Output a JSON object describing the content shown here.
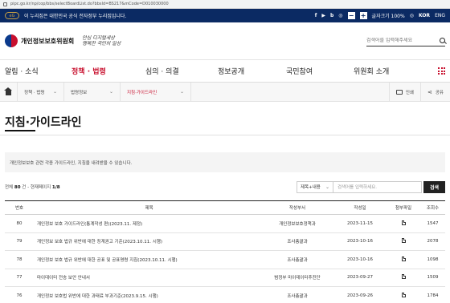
{
  "browser": {
    "url": "pipc.go.kr/np/cop/bbs/selectBoardList.do?bbsId=BS217&mCode=D010030000"
  },
  "govbar": {
    "logo_text": "eG",
    "notice": "이 누리집은 대한민국 공식 전자정부 누리집입니다.",
    "sns": [
      "f",
      "▶",
      "b",
      "◎"
    ],
    "font_minus": "−",
    "font_plus": "+",
    "font_label": "글자크기 100%",
    "lang_kor": "KOR",
    "lang_eng": "ENG"
  },
  "header": {
    "org_name": "개인정보보호위원회",
    "slogan_line1": "안심 디지털세상",
    "slogan_line2": "행복한 국민의 일상",
    "search_placeholder": "검색어를 입력해주세요"
  },
  "gnb": {
    "items": [
      "알림 · 소식",
      "정책 · 법령",
      "심의 · 의결",
      "정보공개",
      "국민참여",
      "위원회 소개"
    ],
    "active_index": 1
  },
  "breadcrumb": {
    "items": [
      "정책 · 법령",
      "법령정보",
      "지침·가이드라인"
    ],
    "chevron": "⌄",
    "print": "인쇄",
    "share": "공유",
    "share_glyph": "⋖"
  },
  "page": {
    "title": "지침·가이드라인",
    "notice": "개인정보보호 관련 각종 가이드라인, 지침을 내려받을 수 있습니다."
  },
  "list": {
    "count_prefix": "전체",
    "count": "80",
    "count_mid": "건 - 현재페이지",
    "page": "1/8",
    "search_type": "제목+내용",
    "search_placeholder": "검색어를 입력하세요.",
    "search_button": "검색"
  },
  "table": {
    "headers": [
      "번호",
      "제목",
      "작성부서",
      "작성일",
      "첨부파일",
      "조회수"
    ],
    "rows": [
      {
        "num": "80",
        "title": "개인정보 보호 가이드라인(통계작성 편)(2023.11. 제정)",
        "dept": "개인정보보호정책과",
        "date": "2023-11-15",
        "views": "1547"
      },
      {
        "num": "79",
        "title": "개인정보 보호 법규 위반에 대한 징계권고 기준(2023.10.11. 시행)",
        "dept": "조사총괄과",
        "date": "2023-10-16",
        "views": "2078"
      },
      {
        "num": "78",
        "title": "개인정보 보호 법규 위반에 대한 공표 및 공표명령 지침(2023.10.11. 시행)",
        "dept": "조사총괄과",
        "date": "2023-10-16",
        "views": "1098"
      },
      {
        "num": "77",
        "title": "마이데이터 전송 보안 안내서",
        "dept": "범정부 마이데이터추진단",
        "date": "2023-09-27",
        "views": "1509"
      },
      {
        "num": "76",
        "title": "개인정보 보호법 위반에 대한 과태료 부과기준(2023.9.15. 시행)",
        "dept": "조사총괄과",
        "date": "2023-09-26",
        "views": "1784"
      }
    ]
  }
}
